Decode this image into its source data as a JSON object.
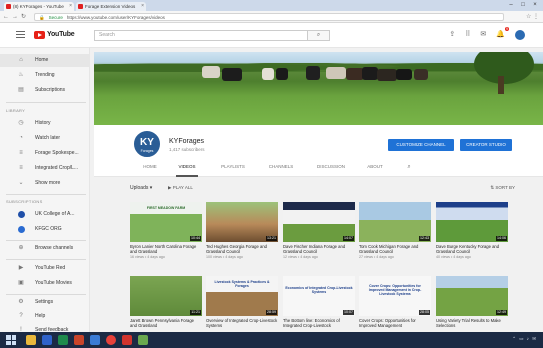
{
  "browser": {
    "tabs": [
      "(8) KYForages - YouTube",
      "Forage Extension Videos"
    ],
    "url": "https://www.youtube.com/user/KYForages/videos",
    "secure_label": "Secure"
  },
  "header": {
    "logo_text": "YouTube",
    "search_placeholder": "Search",
    "notification_count": "9"
  },
  "sidebar": {
    "main": [
      {
        "label": "Home",
        "icon": "home-icon"
      },
      {
        "label": "Trending",
        "icon": "trending-icon"
      },
      {
        "label": "Subscriptions",
        "icon": "subscriptions-icon"
      }
    ],
    "library_heading": "LIBRARY",
    "library": [
      {
        "label": "History",
        "icon": "history-icon"
      },
      {
        "label": "Watch later",
        "icon": "watch-later-icon"
      },
      {
        "label": "Forage Spokespe...",
        "icon": "playlist-icon"
      },
      {
        "label": "Integrated Crop/L...",
        "icon": "playlist-icon"
      },
      {
        "label": "Show more",
        "icon": "chevron-down-icon"
      }
    ],
    "subscriptions_heading": "SUBSCRIPTIONS",
    "subscriptions": [
      {
        "label": "UK College of A...",
        "color": "#1f4fa8"
      },
      {
        "label": "KFGC ORG",
        "color": "#2a6bd1"
      }
    ],
    "browse": {
      "label": "Browse channels",
      "icon": "add-circle-icon"
    },
    "more": [
      {
        "label": "YouTube Red",
        "icon": "youtube-red-icon"
      },
      {
        "label": "YouTube Movies",
        "icon": "film-icon"
      }
    ],
    "bottom": [
      {
        "label": "Settings",
        "icon": "gear-icon"
      },
      {
        "label": "Help",
        "icon": "help-icon"
      },
      {
        "label": "Send feedback",
        "icon": "feedback-icon"
      }
    ]
  },
  "channel": {
    "avatar_main": "KY",
    "avatar_sub": "Forages",
    "name": "KYForages",
    "subscribers": "1,417 subscribers",
    "customize_label": "CUSTOMIZE CHANNEL",
    "studio_label": "CREATOR STUDIO",
    "tabs": [
      "HOME",
      "VIDEOS",
      "PLAYLISTS",
      "CHANNELS",
      "DISCUSSION",
      "ABOUT"
    ],
    "active_tab": "VIDEOS",
    "uploads_label": "Uploads",
    "play_all_label": "PLAY ALL",
    "sort_label": "SORT BY"
  },
  "videos": [
    {
      "title": "Byron Lanier North Carolina Forage and Grassland",
      "meta": "16 views • 4 days ago",
      "duration": "10:44",
      "thumb_text": "FIRST MEADOW FARM"
    },
    {
      "title": "Ted Hughes Georgia Forage and Grassland Council",
      "meta": "100 views • 4 days ago",
      "duration": "13:21",
      "thumb_text": ""
    },
    {
      "title": "Dave Fischer Indiana Forage and Grassland Council",
      "meta": "12 views • 4 days ago",
      "duration": "14:07",
      "thumb_text": ""
    },
    {
      "title": "Tom Cook Michigan Forage and Grassland Council",
      "meta": "27 views • 4 days ago",
      "duration": "12:43",
      "thumb_text": ""
    },
    {
      "title": "Dave Burge Kentucky Forage and Grassland Council",
      "meta": "40 views • 4 days ago",
      "duration": "14:06",
      "thumb_text": ""
    },
    {
      "title": "Jarett Brown Pennsylvania Forage and Grassland",
      "meta": "",
      "duration": "11:21",
      "thumb_text": ""
    },
    {
      "title": "Overview of Integrated Crop-Livestock Systems",
      "meta": "",
      "duration": "28:59",
      "thumb_text": "Livestock Systems & Practices & Forages"
    },
    {
      "title": "The Bottom line: Economics of Integrated Crop-Livestock",
      "meta": "",
      "duration": "10:07",
      "thumb_text": "Economics of Integrated Crop-Livestock Systems"
    },
    {
      "title": "Cover Crops: Opportunities for Improved Management",
      "meta": "",
      "duration": "28:05",
      "thumb_text": "Cover Crops: Opportunities for Improved Management in Crop-Livestock Systems"
    },
    {
      "title": "Using Variety Trial Results to Make Selections",
      "meta": "",
      "duration": "12:49",
      "thumb_text": ""
    }
  ],
  "colors": {
    "youtube_red": "#e62117",
    "button_blue": "#1f72d6",
    "taskbar": "#1b2a44"
  }
}
